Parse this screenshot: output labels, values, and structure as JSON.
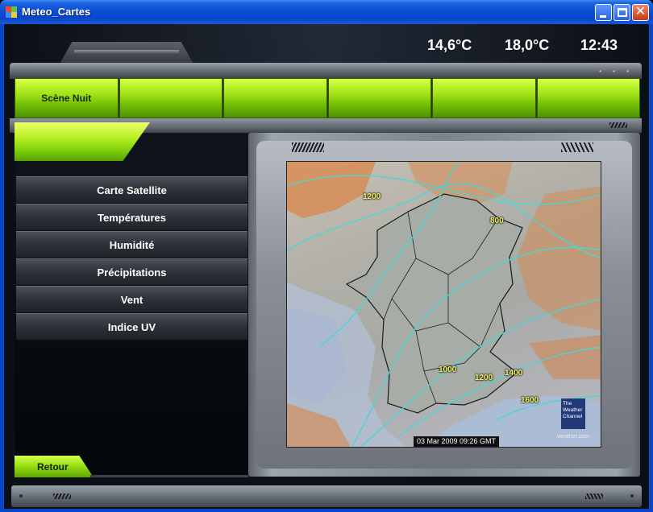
{
  "window": {
    "title": "Meteo_Cartes"
  },
  "header": {
    "temp_outside": "14,6°C",
    "temp_inside": "18,0°C",
    "clock": "12:43"
  },
  "tabs": [
    {
      "label": "Scène Nuit"
    },
    {
      "label": ""
    },
    {
      "label": ""
    },
    {
      "label": ""
    },
    {
      "label": ""
    },
    {
      "label": ""
    }
  ],
  "menu": {
    "items": [
      {
        "label": "Carte Satellite"
      },
      {
        "label": "Températures"
      },
      {
        "label": "Humidité"
      },
      {
        "label": "Précipitations"
      },
      {
        "label": "Vent"
      },
      {
        "label": "Indice UV"
      }
    ],
    "back_label": "Retour"
  },
  "map": {
    "timestamp": "03 Mar 2009 09:26 GMT",
    "brand": "The Weather Channel",
    "site": "weather.com",
    "isolines": [
      "1200",
      "800",
      "1000",
      "1200",
      "1400",
      "1600"
    ]
  },
  "colors": {
    "accent_green": "#a6e81a",
    "isoline": "#49d6d6",
    "label_yellow": "#f5f05a"
  }
}
